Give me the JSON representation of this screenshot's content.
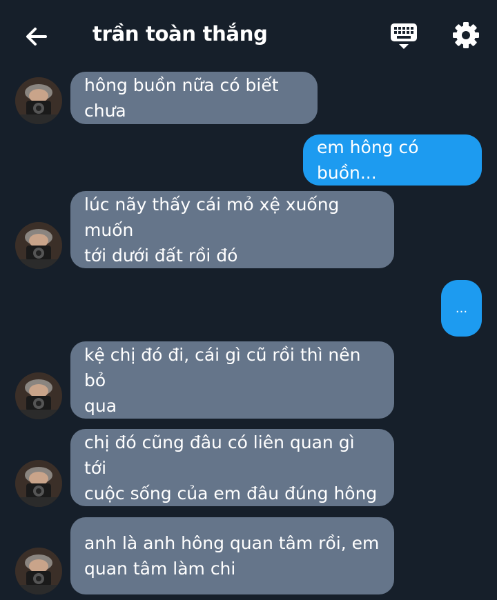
{
  "colors": {
    "background": "#161f2a",
    "incoming": "#65758a",
    "outgoing": "#1d9bf0"
  },
  "header": {
    "back_icon": "arrow-left-icon",
    "title": "trần toàn thắng",
    "keyboard_icon": "keyboard-icon",
    "settings_icon": "gear-icon"
  },
  "messages": [
    {
      "direction": "incoming",
      "text": "hông buồn nữa có biết chưa"
    },
    {
      "direction": "outgoing",
      "text": "em hông có buồn..."
    },
    {
      "direction": "incoming",
      "text": "lúc nãy thấy cái mỏ xệ xuống muốn\ntới dưới đất rồi đó"
    },
    {
      "direction": "outgoing",
      "text": "..."
    },
    {
      "direction": "incoming",
      "text": "kệ chị đó đi, cái gì cũ rồi thì nên bỏ\nqua"
    },
    {
      "direction": "incoming",
      "text": "chị đó cũng đâu có liên quan gì tới\ncuộc sống của em đâu đúng hông"
    },
    {
      "direction": "incoming",
      "text": "anh là anh hông quan tâm rồi, em\nquan tâm làm chi"
    }
  ]
}
